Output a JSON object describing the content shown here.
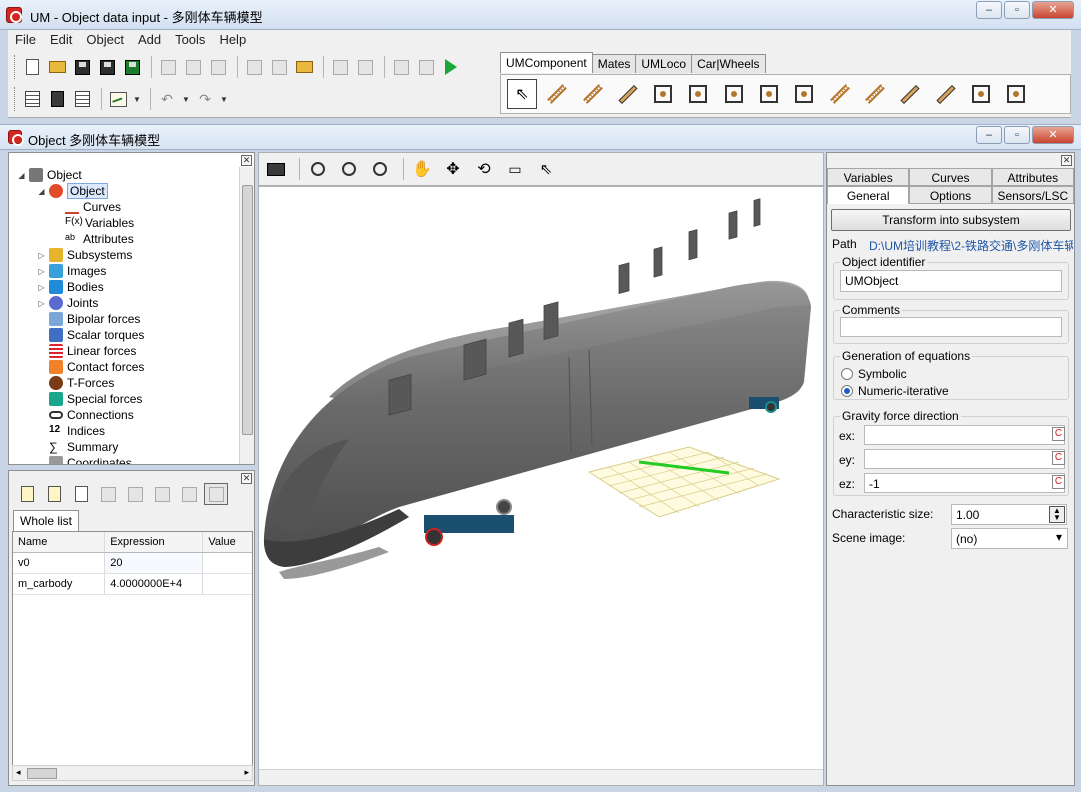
{
  "app": {
    "title": "UM - Object data input - 多刚体车辆模型",
    "mdi_title": "Object 多刚体车辆模型"
  },
  "menu": [
    "File",
    "Edit",
    "Object",
    "Add",
    "Tools",
    "Help"
  ],
  "component_tabs": [
    "UMComponent",
    "Mates",
    "UMLoco",
    "Car|Wheels"
  ],
  "tree": {
    "root": "Object",
    "selected": "Object",
    "children": [
      "Curves",
      "Variables",
      "Attributes"
    ],
    "items": [
      "Subsystems",
      "Images",
      "Bodies",
      "Joints",
      "Bipolar forces",
      "Scalar torques",
      "Linear forces",
      "Contact forces",
      "T-Forces",
      "Special forces",
      "Connections",
      "Indices",
      "Summary",
      "Coordinates"
    ]
  },
  "variables": {
    "tab": "Whole list",
    "columns": [
      "Name",
      "Expression",
      "Value"
    ],
    "rows": [
      {
        "name": "v0",
        "expression": "20",
        "value": ""
      },
      {
        "name": "m_carbody",
        "expression": "4.0000000E+4",
        "value": ""
      }
    ]
  },
  "props": {
    "tabs_row1": [
      "Variables",
      "Curves",
      "Attributes"
    ],
    "tabs_row2": [
      "General",
      "Options",
      "Sensors/LSC"
    ],
    "transform_button": "Transform into subsystem",
    "path_label": "Path",
    "path_value": "D:\\UM培训教程\\2-铁路交通\\多刚体车辆",
    "object_identifier_label": "Object identifier",
    "object_identifier": "UMObject",
    "comments_label": "Comments",
    "comments": "",
    "generation_label": "Generation of equations",
    "gen_symbolic": "Symbolic",
    "gen_numeric": "Numeric-iterative",
    "gravity_label": "Gravity force direction",
    "ex_label": "ex:",
    "ey_label": "ey:",
    "ez_label": "ez:",
    "ex": "",
    "ey": "",
    "ez": "-1",
    "char_size_label": "Characteristic size:",
    "char_size": "1.00",
    "scene_image_label": "Scene image:",
    "scene_image": "(no)"
  },
  "colors": {
    "accent": "#1f5ec4",
    "play": "#19a838",
    "grid_green": "#22cc22"
  }
}
